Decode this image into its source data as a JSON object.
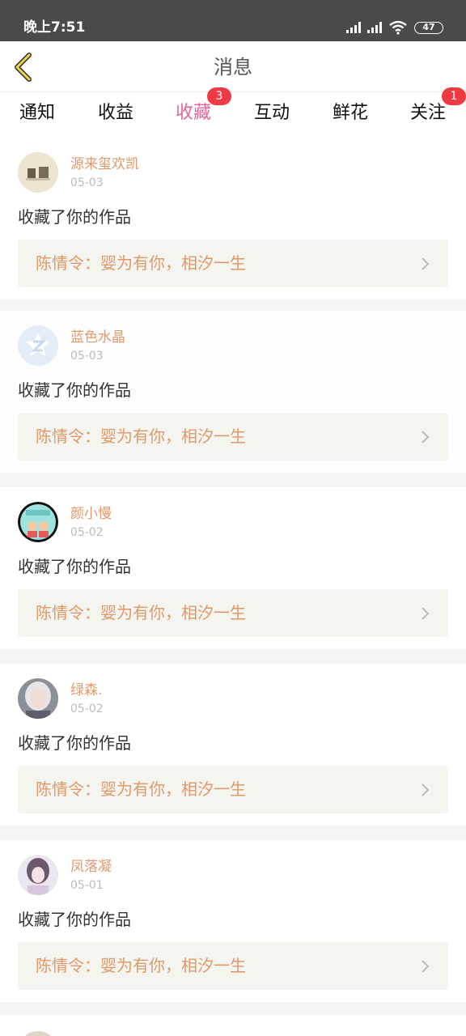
{
  "status_bar": {
    "time": "晚上7:51",
    "battery": "47"
  },
  "header": {
    "title": "消息"
  },
  "tabs": [
    {
      "label": "通知"
    },
    {
      "label": "收益"
    },
    {
      "label": "收藏",
      "active": true,
      "badge": "3"
    },
    {
      "label": "互动"
    },
    {
      "label": "鲜花"
    },
    {
      "label": "关注",
      "badge": "1"
    }
  ],
  "messages": [
    {
      "username": "源来玺欢凯",
      "date": "05-03",
      "action": "收藏了你的作品",
      "work": "陈情令：婴为有你，相汐一生"
    },
    {
      "username": "蓝色水晶",
      "date": "05-03",
      "action": "收藏了你的作品",
      "work": "陈情令：婴为有你，相汐一生"
    },
    {
      "username": "颜小慢",
      "date": "05-02",
      "action": "收藏了你的作品",
      "work": "陈情令：婴为有你，相汐一生"
    },
    {
      "username": "绿森.",
      "date": "05-02",
      "action": "收藏了你的作品",
      "work": "陈情令：婴为有你，相汐一生"
    },
    {
      "username": "凤落凝",
      "date": "05-01",
      "action": "收藏了你的作品",
      "work": "陈情令：婴为有你，相汐一生"
    }
  ]
}
